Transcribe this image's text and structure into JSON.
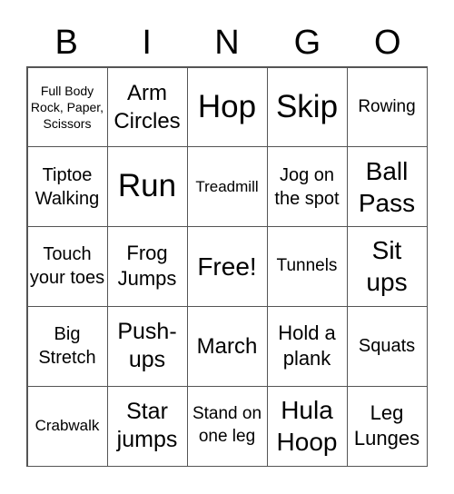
{
  "header": {
    "letters": [
      "B",
      "I",
      "N",
      "G",
      "O"
    ]
  },
  "cells": [
    "Full Body Rock, Paper, Scissors",
    "Arm Circles",
    "Hop",
    "Skip",
    "Rowing",
    "Tiptoe Walking",
    "Run",
    "Treadmill",
    "Jog on the spot",
    "Ball Pass",
    "Touch your toes",
    "Frog Jumps",
    "Free!",
    "Tunnels",
    "Sit ups",
    "Big Stretch",
    "Push-ups",
    "March",
    "Hold a plank",
    "Squats",
    "Crabwalk",
    "Star jumps",
    "Stand on one leg",
    "Hula Hoop",
    "Leg Lunges"
  ]
}
